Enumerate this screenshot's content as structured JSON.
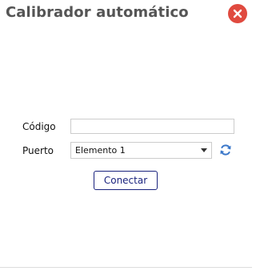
{
  "dialog": {
    "title": "Calibrador automático"
  },
  "form": {
    "code_label": "Código",
    "code_value": "",
    "port_label": "Puerto",
    "port_selected": "Elemento 1",
    "connect_label": "Conectar"
  },
  "icons": {
    "close": "close-icon",
    "refresh": "refresh-icon",
    "dropdown": "chevron-down-icon"
  },
  "colors": {
    "close_bg": "#e04a3f",
    "refresh": "#3a77c9",
    "connect_border": "#1a237e",
    "title": "#555555"
  }
}
